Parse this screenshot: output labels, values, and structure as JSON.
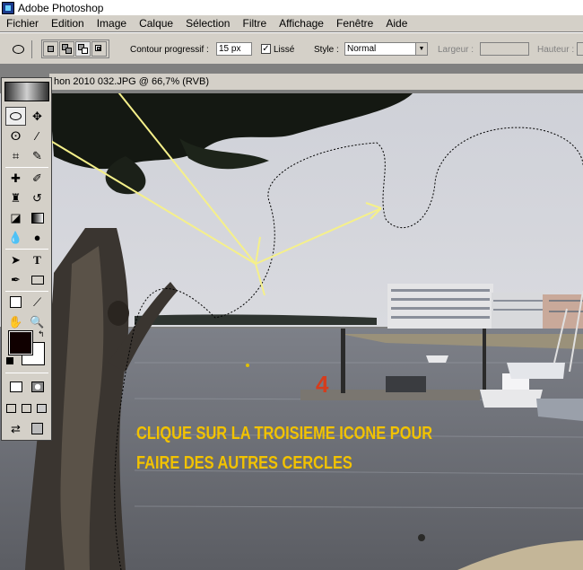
{
  "window": {
    "title": "Adobe Photoshop"
  },
  "menu": [
    "Fichier",
    "Edition",
    "Image",
    "Calque",
    "Sélection",
    "Filtre",
    "Affichage",
    "Fenêtre",
    "Aide"
  ],
  "options": {
    "feather_label": "Contour progressif :",
    "feather_value": "15 px",
    "antialias_label": "Lissé",
    "antialias_checked": true,
    "style_label": "Style :",
    "style_value": "Normal",
    "width_label": "Largeur :",
    "height_label": "Hauteur :"
  },
  "document": {
    "title": "hon 2010 032.JPG @ 66,7% (RVB)"
  },
  "annotation": {
    "line1": "CLIQUE  SUR LA TROISIEME ICONE POUR",
    "line2": "FAIRE DES AUTRES CERCLES",
    "color": "#f2c200"
  },
  "boat_number": "4",
  "colors": {
    "annotation_arrows": "#f5f08a",
    "foreground": "#100000",
    "background": "#ffffff"
  }
}
